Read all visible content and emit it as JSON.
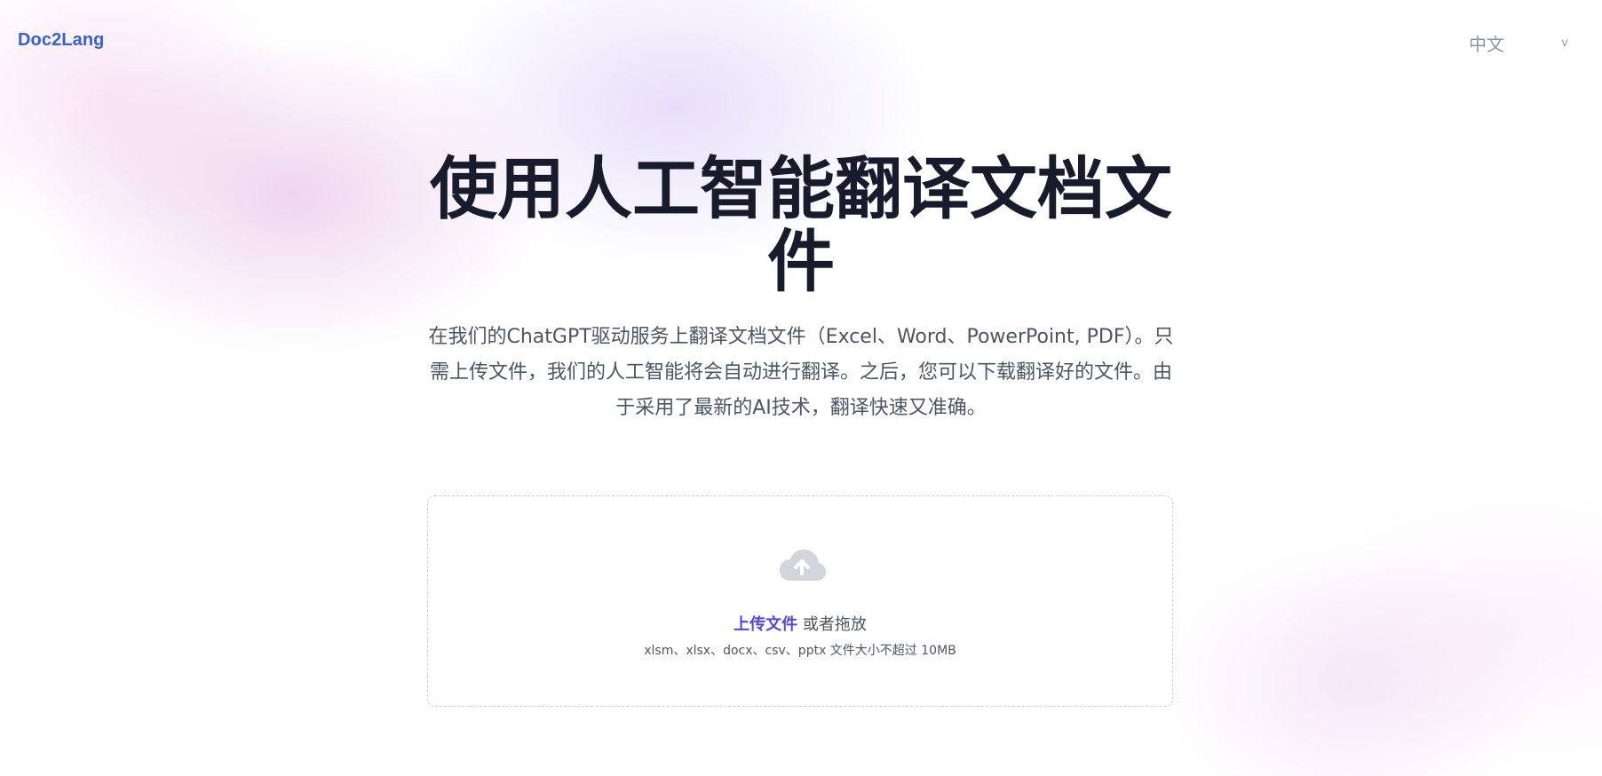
{
  "header": {
    "brand": "Doc2Lang",
    "language": {
      "selected": "中文",
      "caret": "v"
    }
  },
  "hero": {
    "title": "使用人工智能翻译文档文件",
    "description": "在我们的ChatGPT驱动服务上翻译文档文件（Excel、Word、PowerPoint, PDF）。只需上传文件，我们的人工智能将会自动进行翻译。之后，您可以下载翻译好的文件。由于采用了最新的AI技术，翻译快速又准确。"
  },
  "upload": {
    "link_label": "上传文件",
    "or_drag_label": "或者拖放",
    "hint": "xlsm、xlsx、docx、csv、pptx 文件大小不超过 10MB",
    "icon": "cloud-upload-icon"
  },
  "colors": {
    "brand": "#3560d6",
    "upload_link": "#4f46e5",
    "title": "#171b2c",
    "muted_text": "#4b5565",
    "upload_icon": "#d2d5dc"
  }
}
